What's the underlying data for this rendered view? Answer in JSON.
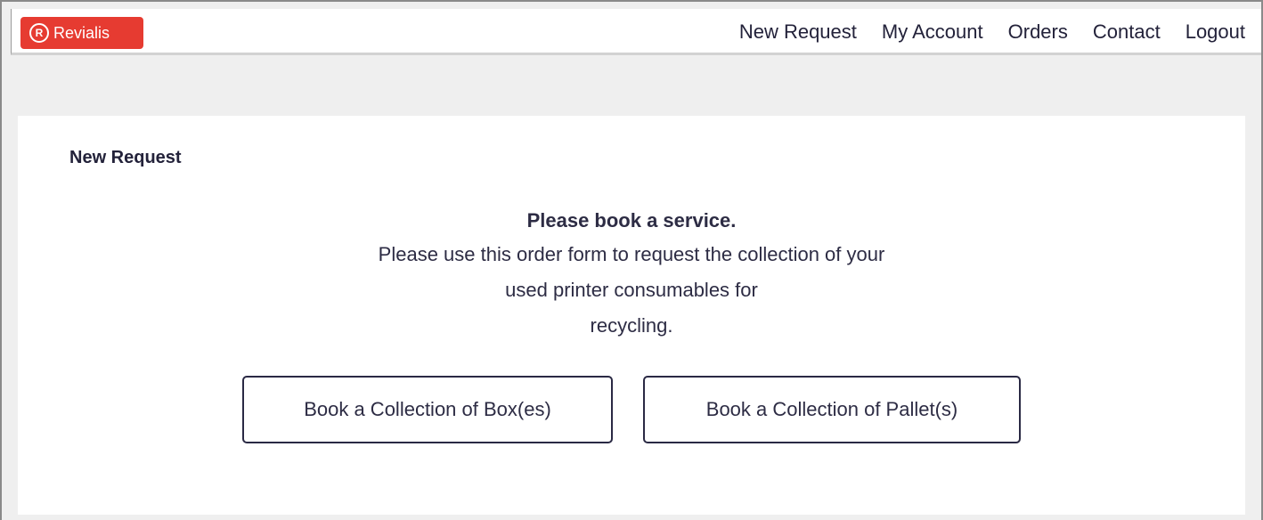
{
  "brand": {
    "name": "Revialis",
    "logo_mark": "R",
    "color": "#e63b31"
  },
  "nav": {
    "items": [
      "New Request",
      "My Account",
      "Orders",
      "Contact",
      "Logout"
    ]
  },
  "page": {
    "title": "New Request",
    "heading": "Please book a service.",
    "lines": [
      "Please use this order form to request the collection of your",
      "used printer consumables for",
      "recycling."
    ]
  },
  "actions": {
    "box_label": "Book a Collection of Box(es)",
    "pallet_label": "Book a Collection of Pallet(s)"
  },
  "colors": {
    "text": "#23223a",
    "background": "#efefef"
  }
}
